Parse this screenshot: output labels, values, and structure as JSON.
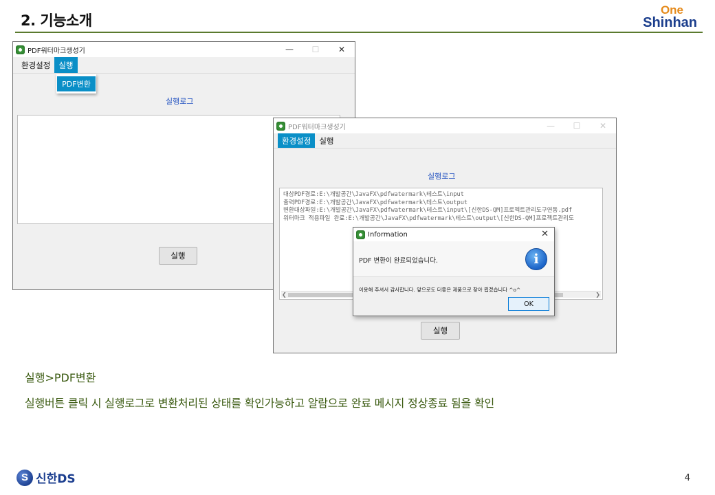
{
  "slide": {
    "title": "2. 기능소개",
    "brand_one": "One",
    "brand_name": "Shinhan",
    "caption1": "실행>PDF변환",
    "caption2": "실행버튼 클릭 시 실행로그로 변환처리된 상태를 확인가능하고 알람으로 완료 메시지 정상종료 됨을 확인",
    "footer_logo_mark": "S",
    "footer_logo_text": "신한DS",
    "page_number": "4"
  },
  "window1": {
    "title": "PDF워터마크생성기",
    "controls": {
      "minimize": "—",
      "maximize": "☐",
      "close": "✕"
    },
    "menu": [
      {
        "label": "환경설정",
        "active": false
      },
      {
        "label": "실행",
        "active": true
      }
    ],
    "dropdown_item": "PDF변환",
    "log_label": "실행로그",
    "run_button": "실행"
  },
  "window2": {
    "title": "PDF워터마크생성기",
    "controls": {
      "minimize": "—",
      "maximize": "☐",
      "close": "✕"
    },
    "menu": [
      {
        "label": "환경설정",
        "active": true
      },
      {
        "label": "실행",
        "active": false
      }
    ],
    "log_label": "실행로그",
    "log_lines": [
      "대상PDF경로:E:\\개발공간\\JavaFX\\pdfwatermark\\테스트\\input",
      "출력PDF경로:E:\\개발공간\\JavaFX\\pdfwatermark\\테스트\\output",
      "변환대상파일:E:\\개발공간\\JavaFX\\pdfwatermark\\테스트\\input\\[신한DS-QM]프로젝트관리도구연동.pdf",
      "워터마크 적용파일 완료:E:\\개발공간\\JavaFX\\pdfwatermark\\테스트\\output\\[신한DS-QM]프로젝트관리도"
    ],
    "run_button": "실행"
  },
  "dialog": {
    "title": "Information",
    "close": "✕",
    "header": "PDF 변환이 완료되었습니다.",
    "icon": "i",
    "body": "이용해 주셔서 감사합니다. 앞으로도 더좋은 제품으로 찾아 뵙겠습니다 ^o^",
    "ok_button": "OK"
  }
}
